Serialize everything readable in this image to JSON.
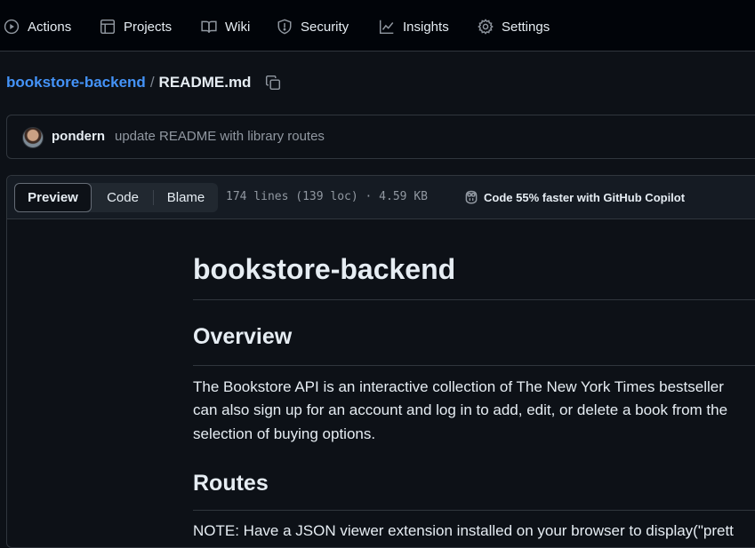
{
  "nav": {
    "items": [
      {
        "label": "Actions",
        "icon": "play-circle-icon"
      },
      {
        "label": "Projects",
        "icon": "table-icon"
      },
      {
        "label": "Wiki",
        "icon": "book-icon"
      },
      {
        "label": "Security",
        "icon": "shield-icon"
      },
      {
        "label": "Insights",
        "icon": "graph-icon"
      },
      {
        "label": "Settings",
        "icon": "gear-icon"
      }
    ]
  },
  "breadcrumb": {
    "repo": "bookstore-backend",
    "separator": "/",
    "file": "README.md"
  },
  "commit": {
    "author": "pondern",
    "message": "update README with library routes"
  },
  "file_header": {
    "tabs": {
      "preview": "Preview",
      "code": "Code",
      "blame": "Blame"
    },
    "active_tab": "Preview",
    "stats": "174 lines (139 loc) · 4.59 KB",
    "copilot": "Code 55% faster with GitHub Copilot"
  },
  "readme": {
    "title": "bookstore-backend",
    "overview_heading": "Overview",
    "overview_lines": [
      "The Bookstore API is an interactive collection of The New York Times bestseller",
      "can also sign up for an account and log in to add, edit, or delete a book from the",
      "selection of buying options."
    ],
    "routes_heading": "Routes",
    "routes_note": "NOTE: Have a JSON viewer extension installed on your browser to display(\"prett"
  },
  "colors": {
    "accent_link": "#4493f8",
    "background": "#0d1117",
    "nav_background": "#010409",
    "border": "#30363d",
    "muted_text": "#9198a1"
  }
}
